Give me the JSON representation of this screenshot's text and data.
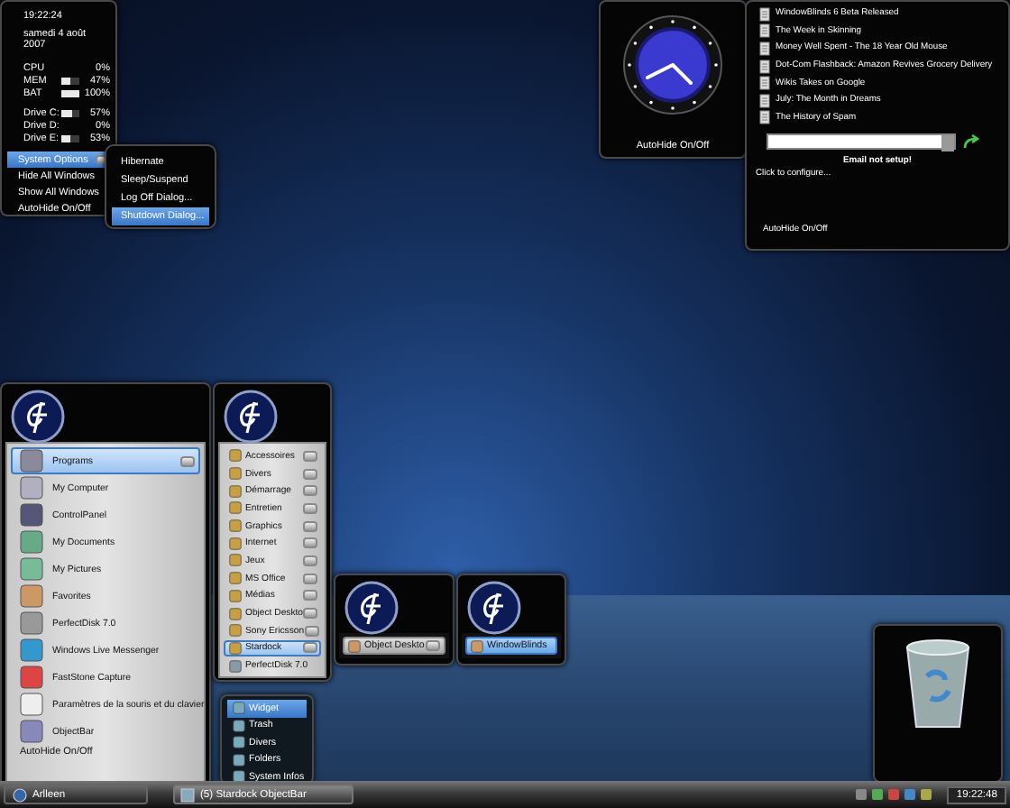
{
  "system_monitor": {
    "time": "19:22:24",
    "date": "samedi 4 août 2007",
    "stats": [
      {
        "label": "CPU",
        "value": "0%",
        "kind": "plain"
      },
      {
        "label": "MEM",
        "value": "47%",
        "kind": "meter",
        "level": 0.47
      },
      {
        "label": "BAT",
        "value": "100%",
        "kind": "meter",
        "level": 1
      },
      {
        "label": "Drive C:",
        "value": "57%",
        "kind": "meter",
        "level": 0.57
      },
      {
        "label": "Drive D:",
        "value": "0%",
        "kind": "plain"
      },
      {
        "label": "Drive E:",
        "value": "53%",
        "kind": "meter",
        "level": 0.53
      }
    ],
    "menu": [
      {
        "label": "System Options",
        "selected": true,
        "has_submenu": true
      },
      {
        "label": "Hide All Windows",
        "selected": false,
        "has_submenu": false
      },
      {
        "label": "Show All Windows",
        "selected": false,
        "has_submenu": false
      },
      {
        "label": "AutoHide On/Off",
        "selected": false,
        "has_submenu": false
      }
    ]
  },
  "power_menu": [
    {
      "label": "Hibernate",
      "selected": false
    },
    {
      "label": "Sleep/Suspend",
      "selected": false
    },
    {
      "label": "Log Off Dialog...",
      "selected": false
    },
    {
      "label": "Shutdown Dialog...",
      "selected": true
    }
  ],
  "clock_widget": {
    "autohide": "AutoHide On/Off"
  },
  "news_feed": {
    "items": [
      "WindowBlinds 6 Beta Released",
      "The Week in Skinning",
      "Money Well Spent - The 18 Year Old Mouse",
      "Dot-Com Flashback: Amazon Revives Grocery Delivery",
      "Wikis Takes on Google",
      "July: The Month in Dreams",
      "The History of Spam"
    ],
    "email_status": "Email not setup!",
    "configure": "Click to configure...",
    "autohide": "AutoHide On/Off"
  },
  "start_menu": {
    "items": [
      {
        "label": "Programs",
        "selected": true,
        "has_submenu": true
      },
      {
        "label": "My Computer",
        "selected": false,
        "has_submenu": false
      },
      {
        "label": "ControlPanel",
        "selected": false,
        "has_submenu": false
      },
      {
        "label": "My Documents",
        "selected": false,
        "has_submenu": false
      },
      {
        "label": "My Pictures",
        "selected": false,
        "has_submenu": false
      },
      {
        "label": "Favorites",
        "selected": false,
        "has_submenu": false
      },
      {
        "label": "PerfectDisk 7.0",
        "selected": false,
        "has_submenu": false
      },
      {
        "label": "Windows Live Messenger",
        "selected": false,
        "has_submenu": false
      },
      {
        "label": "FastStone Capture",
        "selected": false,
        "has_submenu": false
      },
      {
        "label": "Paramètres de la souris et du clavier",
        "selected": false,
        "has_submenu": false
      },
      {
        "label": "ObjectBar",
        "selected": false,
        "has_submenu": false
      }
    ],
    "autohide": "AutoHide On/Off"
  },
  "programs_menu": [
    {
      "label": "Accessoires",
      "kind": "folder",
      "selected": false
    },
    {
      "label": "Divers",
      "kind": "folder",
      "selected": false
    },
    {
      "label": "Démarrage",
      "kind": "folder",
      "selected": false
    },
    {
      "label": "Entretien",
      "kind": "folder",
      "selected": false
    },
    {
      "label": "Graphics",
      "kind": "folder",
      "selected": false
    },
    {
      "label": "Internet",
      "kind": "folder",
      "selected": false
    },
    {
      "label": "Jeux",
      "kind": "folder",
      "selected": false
    },
    {
      "label": "MS Office",
      "kind": "folder",
      "selected": false
    },
    {
      "label": "Médias",
      "kind": "folder",
      "selected": false
    },
    {
      "label": "Object Deskto",
      "kind": "folder",
      "selected": false
    },
    {
      "label": "Sony Ericsson",
      "kind": "folder",
      "selected": false
    },
    {
      "label": "Stardock",
      "kind": "folder",
      "selected": true
    },
    {
      "label": "PerfectDisk 7.0",
      "kind": "app",
      "selected": false
    }
  ],
  "docks": [
    {
      "label": "Object Deskto",
      "has_submenu": true,
      "selected": false
    },
    {
      "label": "WindowBlinds",
      "has_submenu": false,
      "selected": true
    }
  ],
  "widget_menu": [
    {
      "label": "Widget",
      "selected": true
    },
    {
      "label": "Trash",
      "selected": false
    },
    {
      "label": "Divers",
      "selected": false
    },
    {
      "label": "Folders",
      "selected": false
    },
    {
      "label": "System Infos",
      "selected": false
    }
  ],
  "taskbar": {
    "start": "Arlleen",
    "tasks": [
      "(5) Stardock ObjectBar"
    ],
    "clock": "19:22:48"
  }
}
